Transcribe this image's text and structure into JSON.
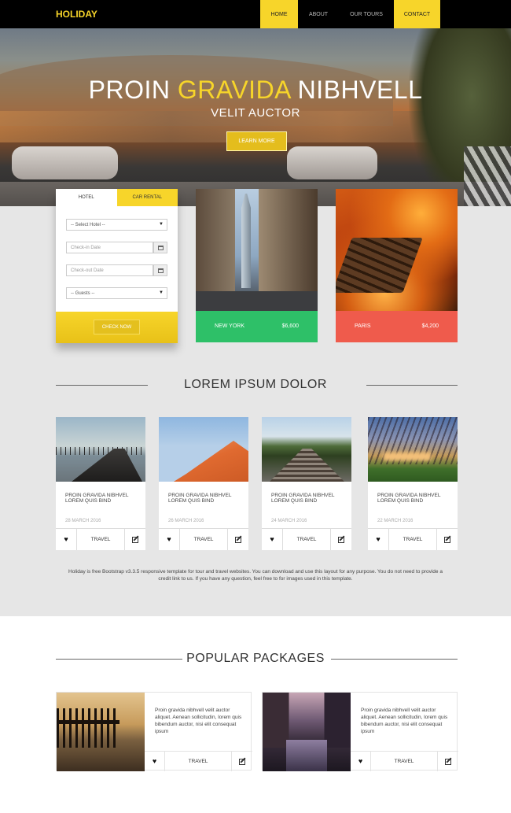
{
  "nav": {
    "brand": "HOLIDAY",
    "items": [
      "HOME",
      "ABOUT",
      "OUR TOURS",
      "CONTACT"
    ]
  },
  "hero": {
    "title_part1": "PROIN",
    "title_highlight": "GRAVIDA",
    "title_part2": "NIBHVELL",
    "subtitle": "VELIT AUCTOR",
    "button": "LEARN MORE"
  },
  "booking": {
    "tabs": [
      "HOTEL",
      "CAR RENTAL"
    ],
    "select_hotel": "-- Select Hotel --",
    "checkin_placeholder": "Check-in Date",
    "checkout_placeholder": "Check-out Date",
    "guests": "-- Guests --",
    "submit": "CHECK NOW"
  },
  "destinations": [
    {
      "city": "NEW YORK",
      "price": "$6,600",
      "color": "#2ec068"
    },
    {
      "city": "PARIS",
      "price": "$4,200",
      "color": "#ef5b4c"
    }
  ],
  "section1": {
    "title": "LOREM IPSUM DOLOR"
  },
  "articles": [
    {
      "title": "PROIN GRAVIDA NIBHVEL LOREM QUIS BIND",
      "date": "28 MARCH 2016",
      "tag": "TRAVEL"
    },
    {
      "title": "PROIN GRAVIDA NIBHVEL LOREM QUIS BIND",
      "date": "26 MARCH 2016",
      "tag": "TRAVEL"
    },
    {
      "title": "PROIN GRAVIDA NIBHVEL LOREM QUIS BIND",
      "date": "24 MARCH 2016",
      "tag": "TRAVEL"
    },
    {
      "title": "PROIN GRAVIDA NIBHVEL LOREM QUIS BIND",
      "date": "22 MARCH 2016",
      "tag": "TRAVEL"
    }
  ],
  "note": "Holiday is free Bootstrap v3.3.5 responsive template for tour and travel websites. You can download and use this layout for any purpose. You do not need to provide a credit link to us. If you have any question, feel free to for images used in this template.",
  "section2": {
    "title": "POPULAR PACKAGES"
  },
  "packages": [
    {
      "text": "Proin gravida nibhvell velit auctor aliquet. Aenean sollicitudin, lorem quis bibendum auctor, nisi elit consequat ipsum",
      "tag": "TRAVEL"
    },
    {
      "text": "Proin gravida nibhvell velit auctor aliquet. Aenean sollicitudin, lorem quis bibendum auctor, nisi elit consequat ipsum",
      "tag": "TRAVEL"
    }
  ],
  "colors": {
    "accent": "#f7d52a",
    "green": "#2ec068",
    "red": "#ef5b4c"
  }
}
